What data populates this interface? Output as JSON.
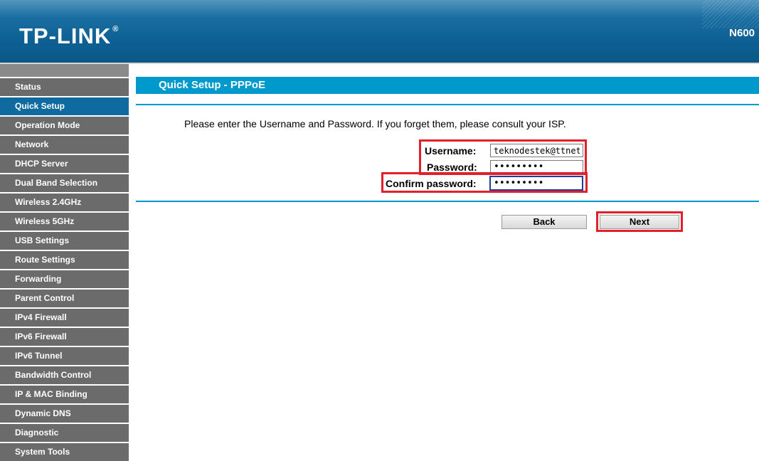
{
  "header": {
    "brand": "TP-LINK",
    "registered_mark": "®",
    "model": "N600"
  },
  "sidebar": {
    "items": [
      {
        "label": "Status",
        "active": false
      },
      {
        "label": "Quick Setup",
        "active": true
      },
      {
        "label": "Operation Mode",
        "active": false
      },
      {
        "label": "Network",
        "active": false
      },
      {
        "label": "DHCP Server",
        "active": false
      },
      {
        "label": "Dual Band Selection",
        "active": false
      },
      {
        "label": "Wireless 2.4GHz",
        "active": false
      },
      {
        "label": "Wireless 5GHz",
        "active": false
      },
      {
        "label": "USB Settings",
        "active": false
      },
      {
        "label": "Route Settings",
        "active": false
      },
      {
        "label": "Forwarding",
        "active": false
      },
      {
        "label": "Parent Control",
        "active": false
      },
      {
        "label": "IPv4 Firewall",
        "active": false
      },
      {
        "label": "IPv6 Firewall",
        "active": false
      },
      {
        "label": "IPv6 Tunnel",
        "active": false
      },
      {
        "label": "Bandwidth Control",
        "active": false
      },
      {
        "label": "IP & MAC Binding",
        "active": false
      },
      {
        "label": "Dynamic DNS",
        "active": false
      },
      {
        "label": "Diagnostic",
        "active": false
      },
      {
        "label": "System Tools",
        "active": false
      }
    ]
  },
  "main": {
    "title": "Quick Setup - PPPoE",
    "instructions": "Please enter the Username and Password. If you forget them, please consult your ISP.",
    "form": {
      "username_label": "Username:",
      "username_value": "teknodestek@ttnet",
      "password_label": "Password:",
      "password_value": "•••••••••",
      "confirm_label": "Confirm password:",
      "confirm_value": "•••••••••"
    },
    "buttons": {
      "back": "Back",
      "next": "Next"
    }
  },
  "colors": {
    "header_blue": "#0d5f93",
    "title_bar": "#0099cc",
    "sidebar_gray": "#6b6b6b",
    "sidebar_active": "#0f6aa0",
    "highlight_red": "#e0202a"
  }
}
